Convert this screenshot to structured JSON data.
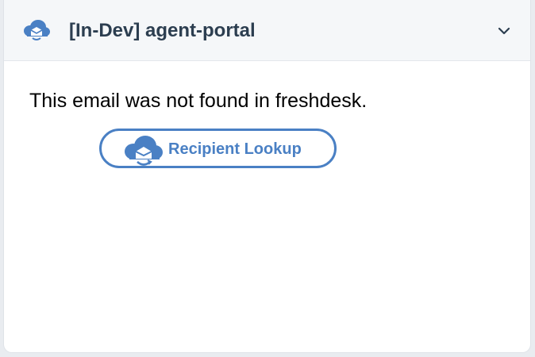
{
  "header": {
    "title": "[In-Dev] agent-portal",
    "icon": "cloud-mail-icon",
    "collapse_icon": "chevron-down-icon"
  },
  "main": {
    "message": "This email was not found in freshdesk.",
    "lookup_button": {
      "label": "Recipient Lookup",
      "icon": "cloud-mail-icon"
    }
  },
  "colors": {
    "accent": "#4a80c4",
    "title": "#2c3e50",
    "header_bg": "#f5f7f9"
  }
}
